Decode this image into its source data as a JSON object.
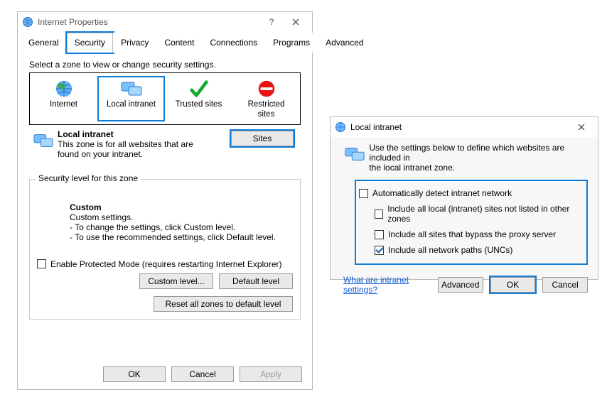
{
  "dlg1": {
    "title": "Internet Properties",
    "help": "?",
    "tabs": {
      "general": "General",
      "security": "Security",
      "privacy": "Privacy",
      "content": "Content",
      "connections": "Connections",
      "programs": "Programs",
      "advanced": "Advanced"
    },
    "active_tab": "security",
    "select_zone_label": "Select a zone to view or change security settings.",
    "zones": {
      "internet": "Internet",
      "local_intranet": "Local intranet",
      "trusted": "Trusted sites",
      "restricted_l1": "Restricted",
      "restricted_l2": "sites"
    },
    "zone_desc": {
      "name": "Local intranet",
      "line1": "This zone is for all websites that are",
      "line2": "found on your intranet."
    },
    "sites_btn": "Sites",
    "sec_group_label": "Security level for this zone",
    "custom_title": "Custom",
    "custom_l1": "Custom settings.",
    "custom_l2": "- To change the settings, click Custom level.",
    "custom_l3": "- To use the recommended settings, click Default level.",
    "protected_mode": "Enable Protected Mode (requires restarting Internet Explorer)",
    "custom_level_btn": "Custom level...",
    "default_level_btn": "Default level",
    "reset_btn": "Reset all zones to default level",
    "ok": "OK",
    "cancel": "Cancel",
    "apply": "Apply"
  },
  "dlg2": {
    "title": "Local intranet",
    "instr_l1": "Use the settings below to define which websites are included in",
    "instr_l2": "the local intranet zone.",
    "opt_auto": "Automatically detect intranet network",
    "opt_local": "Include all local (intranet) sites not listed in other zones",
    "opt_proxy": "Include all sites that bypass the proxy server",
    "opt_unc": "Include all network paths (UNCs)",
    "checked": {
      "auto": false,
      "local": false,
      "proxy": false,
      "unc": true
    },
    "link": "What are intranet settings?",
    "advanced": "Advanced",
    "ok": "OK",
    "cancel": "Cancel"
  }
}
